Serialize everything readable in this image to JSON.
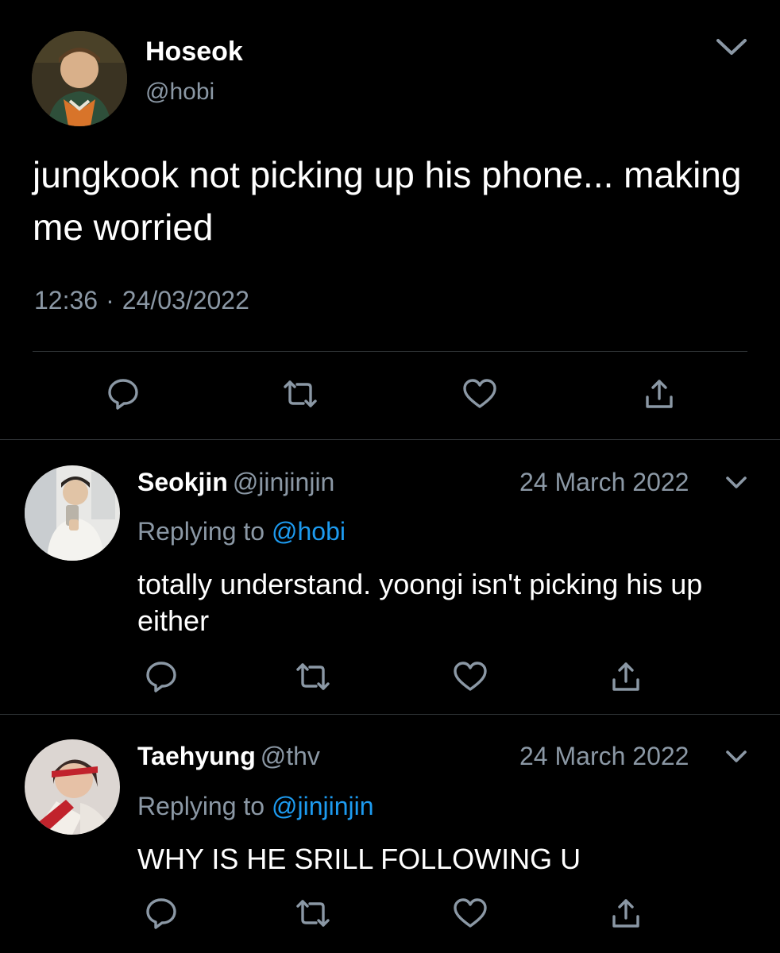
{
  "main_tweet": {
    "author_name": "Hoseok",
    "author_handle": "@hobi",
    "text": "jungkook not picking up his phone... making me worried",
    "time": "12:36",
    "separator": "·",
    "date": "24/03/2022",
    "icons": [
      "reply-icon",
      "retweet-icon",
      "like-icon",
      "share-icon",
      "chevron-down-icon"
    ]
  },
  "replies": [
    {
      "author_name": "Seokjin",
      "author_handle": "@jinjinjin",
      "date": "24 March 2022",
      "replying_prefix": "Replying to",
      "replying_to": "@hobi",
      "text": "totally understand. yoongi isn't picking his up either"
    },
    {
      "author_name": "Taehyung",
      "author_handle": "@thv",
      "date": "24 March 2022",
      "replying_prefix": "Replying to",
      "replying_to": "@jinjinjin",
      "text": "WHY IS HE SRILL FOLLOWING U"
    }
  ],
  "colors": {
    "background": "#000000",
    "primary_text": "#ffffff",
    "secondary_text": "#8b98a5",
    "mention": "#1d9bf0",
    "divider": "#2f3336",
    "icon": "#8b98a5"
  }
}
